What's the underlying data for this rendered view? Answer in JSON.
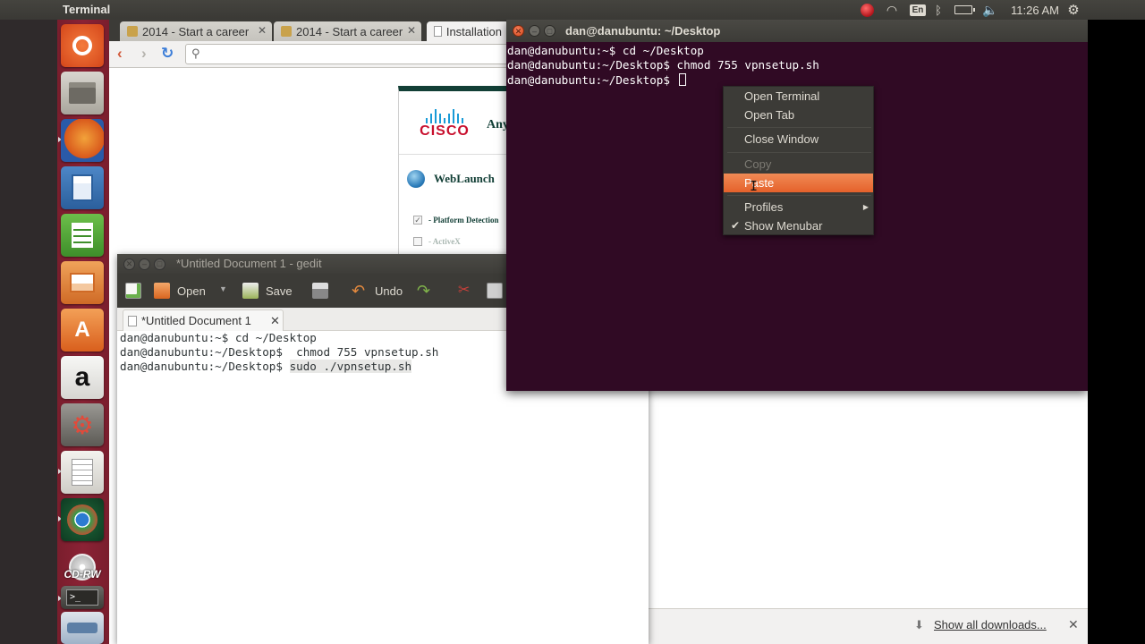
{
  "top_panel": {
    "app_title": "Terminal",
    "keyboard_layout": "En",
    "clock": "11:26 AM",
    "icons": [
      "indicator-red-icon",
      "wifi-icon",
      "keyboard-layout-icon",
      "bluetooth-icon",
      "battery-icon",
      "volume-icon",
      "session-gear-icon"
    ]
  },
  "launcher": {
    "items": [
      "ubuntu-dash-icon",
      "files-icon",
      "firefox-icon",
      "writer-icon",
      "calc-icon",
      "impress-icon",
      "software-center-icon",
      "amazon-icon",
      "system-settings-icon",
      "gedit-icon",
      "chrome-icon",
      "cdrw-icon",
      "terminal-icon",
      "drive-icon"
    ],
    "cdrw_label": "CD-RW"
  },
  "browser": {
    "tabs": [
      {
        "label": "2014 - Start a career"
      },
      {
        "label": "2014 - Start a career"
      },
      {
        "label": "Installation"
      }
    ],
    "search_icon": "search-icon",
    "page": {
      "vendor": "CISCO",
      "product_fragment": "Any",
      "section": "WebLaunch",
      "checks": [
        {
          "label": "- Platform Detection",
          "checked": true
        },
        {
          "label": "- ActiveX",
          "checked": false
        }
      ]
    },
    "downloads": {
      "label": "Show all downloads..."
    }
  },
  "gedit": {
    "title": "*Untitled Document 1 - gedit",
    "toolbar": {
      "open": "Open",
      "save": "Save",
      "undo": "Undo"
    },
    "tab_label": "*Untitled Document 1",
    "lines": [
      "dan@danubuntu:~$ cd ~/Desktop",
      "dan@danubuntu:~/Desktop$  chmod 755 vpnsetup.sh"
    ],
    "last_line_prefix": "dan@danubuntu:~/Desktop$ ",
    "last_line_selected": "sudo ./vpnsetup.sh"
  },
  "terminal": {
    "title": "dan@danubuntu: ~/Desktop",
    "lines": [
      "dan@danubuntu:~$ cd ~/Desktop",
      "dan@danubuntu:~/Desktop$ chmod 755 vpnsetup.sh"
    ],
    "prompt": "dan@danubuntu:~/Desktop$ ",
    "foreground": "#ffffff",
    "background": "#300a24"
  },
  "context_menu": {
    "items": [
      {
        "label": "Open Terminal",
        "enabled": true
      },
      {
        "label": "Open Tab",
        "enabled": true
      },
      {
        "label": "Close Window",
        "enabled": true
      },
      {
        "label": "Copy",
        "enabled": false
      },
      {
        "label": "Paste",
        "enabled": true,
        "highlighted": true
      },
      {
        "label": "Profiles",
        "enabled": true,
        "submenu": true
      },
      {
        "label": "Show Menubar",
        "enabled": true,
        "checked": true
      }
    ],
    "highlight_color": "#e9642f"
  }
}
